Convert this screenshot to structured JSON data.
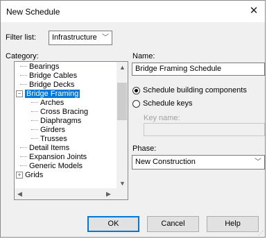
{
  "window": {
    "title": "New Schedule",
    "close_glyph": "✕"
  },
  "filter": {
    "label": "Filter list:",
    "value": "Infrastructure"
  },
  "category": {
    "label": "Category:",
    "items": [
      {
        "label": "Bearings",
        "level": 0,
        "expander": "",
        "selected": false
      },
      {
        "label": "Bridge Cables",
        "level": 0,
        "expander": "",
        "selected": false
      },
      {
        "label": "Bridge Decks",
        "level": 0,
        "expander": "",
        "selected": false
      },
      {
        "label": "Bridge Framing",
        "level": 0,
        "expander": "−",
        "selected": true
      },
      {
        "label": "Arches",
        "level": 1,
        "expander": "",
        "selected": false
      },
      {
        "label": "Cross Bracing",
        "level": 1,
        "expander": "",
        "selected": false
      },
      {
        "label": "Diaphragms",
        "level": 1,
        "expander": "",
        "selected": false
      },
      {
        "label": "Girders",
        "level": 1,
        "expander": "",
        "selected": false
      },
      {
        "label": "Trusses",
        "level": 1,
        "expander": "",
        "selected": false
      },
      {
        "label": "Detail Items",
        "level": 0,
        "expander": "",
        "selected": false
      },
      {
        "label": "Expansion Joints",
        "level": 0,
        "expander": "",
        "selected": false
      },
      {
        "label": "Generic Models",
        "level": 0,
        "expander": "",
        "selected": false
      },
      {
        "label": "Grids",
        "level": 0,
        "expander": "+",
        "selected": false
      }
    ]
  },
  "name": {
    "label": "Name:",
    "value": "Bridge Framing Schedule"
  },
  "radios": {
    "building_components": {
      "label": "Schedule building components",
      "checked": true
    },
    "schedule_keys": {
      "label": "Schedule keys",
      "checked": false
    }
  },
  "key_name": {
    "label": "Key name:",
    "value": ""
  },
  "phase": {
    "label": "Phase:",
    "value": "New Construction"
  },
  "buttons": {
    "ok": "OK",
    "cancel": "Cancel",
    "help": "Help"
  },
  "glyphs": {
    "chevron_down": "﹀",
    "up": "▲",
    "down": "▼",
    "left": "◀",
    "right": "▶"
  }
}
